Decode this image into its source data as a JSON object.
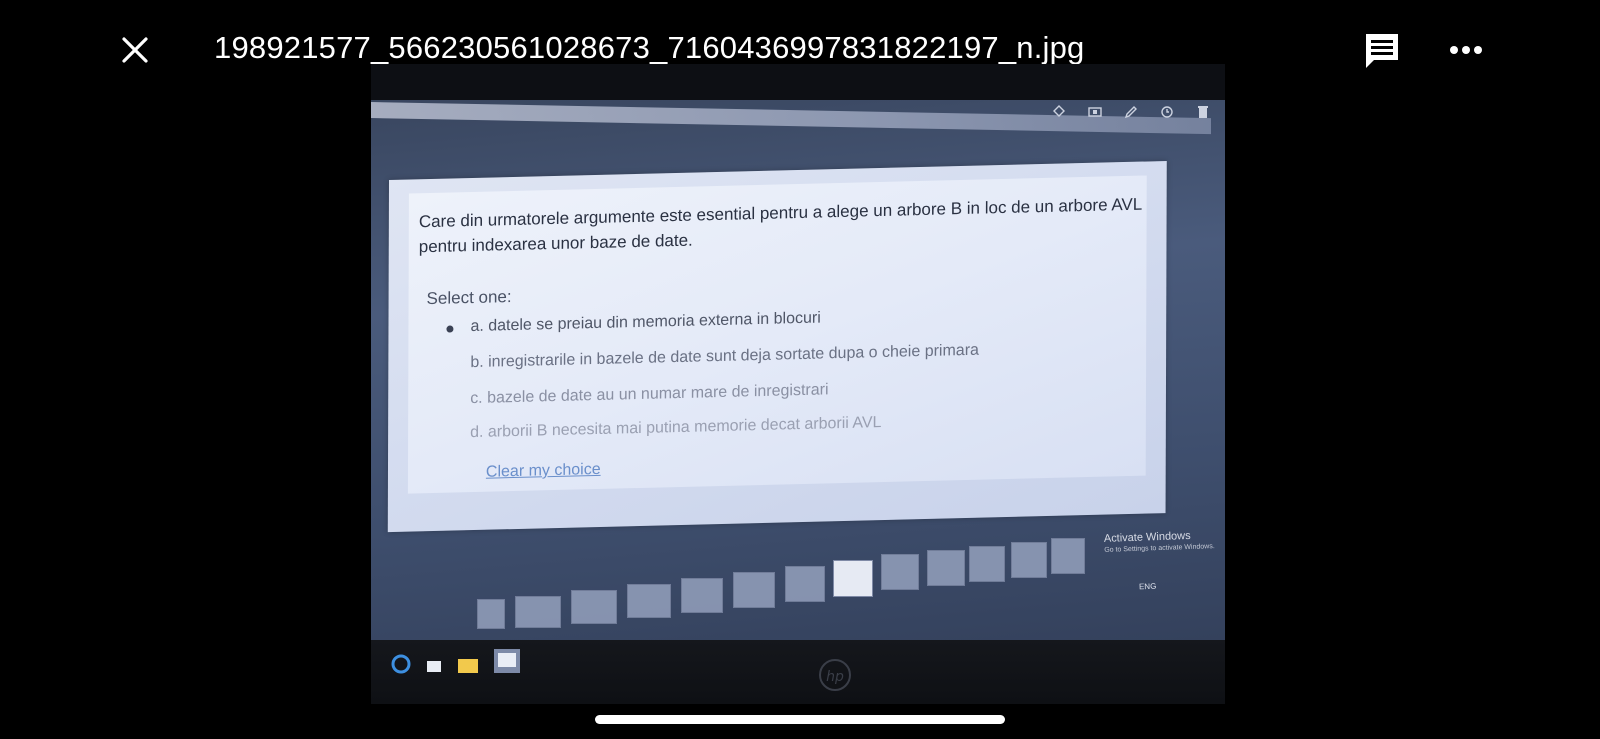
{
  "viewer": {
    "filename": "198921577_566230561028673_7160436997831822197_n.jpg",
    "close_icon": "close-icon",
    "comment_icon": "comment-icon",
    "more_icon": "more-horizontal-icon"
  },
  "photo": {
    "quiz": {
      "question": "Care din urmatorele argumente este esential pentru a alege un arbore B in loc de un arbore AVL pentru indexarea unor baze de date.",
      "select_label": "Select one:",
      "options": [
        {
          "label": "a. datele se preiau din memoria externa in blocuri",
          "selected": true
        },
        {
          "label": "b. inregistrarile in bazele de date sunt deja sortate dupa o cheie primara",
          "selected": false
        },
        {
          "label": "c. bazele de date au un numar mare de inregistrari",
          "selected": false
        },
        {
          "label": "d. arborii B necesita mai putina memorie decat arborii AVL",
          "selected": false
        }
      ],
      "clear_label": "Clear my choice"
    },
    "watermark": {
      "title": "Activate Windows",
      "subtitle": "Go to Settings to activate Windows."
    },
    "tray_text": "ENG",
    "brand": "hp"
  },
  "colors": {
    "background": "#000000",
    "text": "#ffffff",
    "link": "#6a8fcb"
  }
}
